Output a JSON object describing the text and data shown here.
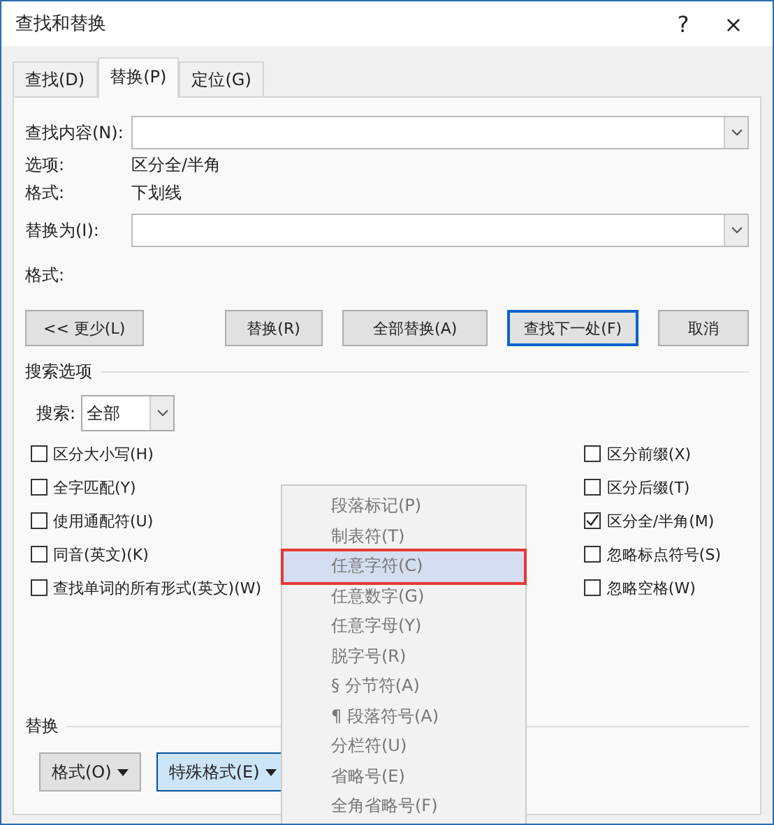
{
  "window": {
    "title": "查找和替换",
    "help": "?",
    "close": "×"
  },
  "tabs": [
    {
      "label": "查找(D)",
      "selected": false
    },
    {
      "label": "替换(P)",
      "selected": true
    },
    {
      "label": "定位(G)",
      "selected": false
    }
  ],
  "find": {
    "label": "查找内容(N):",
    "options_label": "选项:",
    "options_value": "区分全/半角",
    "format_label": "格式:",
    "format_value": "下划线"
  },
  "replace": {
    "label": "替换为(I):",
    "format_label": "格式:"
  },
  "buttons": [
    {
      "label": "<< 更少(L)",
      "default": false
    },
    {
      "label": "替换(R)",
      "default": false
    },
    {
      "label": "全部替换(A)",
      "default": false
    },
    {
      "label": "查找下一处(F)",
      "default": true
    },
    {
      "label": "取消",
      "default": false
    }
  ],
  "search_options": {
    "title": "搜索选项",
    "search_label": "搜索:",
    "search_value": "全部",
    "left": [
      {
        "label": "区分大小写(H)",
        "checked": false
      },
      {
        "label": "全字匹配(Y)",
        "checked": false
      },
      {
        "label": "使用通配符(U)",
        "checked": false
      },
      {
        "label": "同音(英文)(K)",
        "checked": false
      },
      {
        "label": "查找单词的所有形式(英文)(W)",
        "checked": false
      }
    ],
    "right": [
      {
        "label": "区分前缀(X)",
        "checked": false
      },
      {
        "label": "区分后缀(T)",
        "checked": false
      },
      {
        "label": "区分全/半角(M)",
        "checked": true
      },
      {
        "label": "忽略标点符号(S)",
        "checked": false
      },
      {
        "label": "忽略空格(W)",
        "checked": false
      }
    ]
  },
  "replace_section": {
    "title": "替换",
    "buttons": [
      {
        "label": "格式(O)",
        "pressed": false
      },
      {
        "label": "特殊格式(E)",
        "pressed": true
      }
    ]
  },
  "menu": [
    {
      "label": "段落标记(P)",
      "selected": false
    },
    {
      "label": "制表符(T)",
      "selected": false
    },
    {
      "label": "任意字符(C)",
      "selected": true
    },
    {
      "label": "任意数字(G)",
      "selected": false
    },
    {
      "label": "任意字母(Y)",
      "selected": false
    },
    {
      "label": "脱字号(R)",
      "selected": false
    },
    {
      "label": "§ 分节符(A)",
      "selected": false
    },
    {
      "label": "¶ 段落符号(A)",
      "selected": false
    },
    {
      "label": "分栏符(U)",
      "selected": false
    },
    {
      "label": "省略号(E)",
      "selected": false
    },
    {
      "label": "全角省略号(F)",
      "selected": false
    }
  ]
}
